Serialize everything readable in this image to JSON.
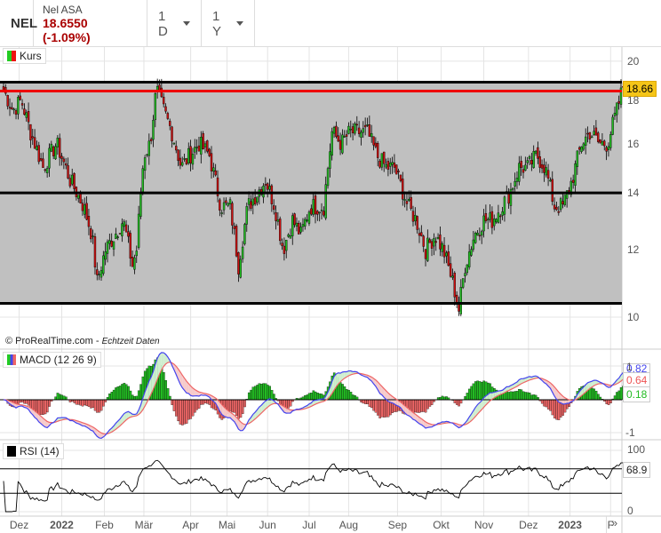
{
  "header": {
    "symbol": "NEL",
    "name": "Nel ASA",
    "price": "18.6550 (-1.09%)",
    "interval": "1 D",
    "range": "1 Y"
  },
  "panels": {
    "price_label": "Kurs",
    "macd_label": "MACD (12 26 9)",
    "rsi_label": "RSI (14)",
    "credit": "© ProRealTime.com",
    "credit_sub": "Echtzeit Daten",
    "more_icon": "»"
  },
  "colors": {
    "up": "#22bb22",
    "down": "#cc1111",
    "macd": "#4444ee",
    "signal": "#ee6666",
    "band": "#c0c0c0",
    "last": "#f5c518"
  },
  "chart_data": {
    "type": "candlestick",
    "x_unit": "weeks since start",
    "price_axis": {
      "ticks": [
        "20",
        "18",
        "16",
        "14",
        "12",
        "10"
      ],
      "range": [
        9.6,
        20.6
      ],
      "scale": "log"
    },
    "x_ticks": [
      {
        "label": "Dez",
        "w": 1.5
      },
      {
        "label": "2022",
        "w": 5.6,
        "bold": true
      },
      {
        "label": "Feb",
        "w": 9.7
      },
      {
        "label": "Mär",
        "w": 13.5
      },
      {
        "label": "Apr",
        "w": 18
      },
      {
        "label": "Mai",
        "w": 21.5
      },
      {
        "label": "Jun",
        "w": 25.4
      },
      {
        "label": "Jul",
        "w": 29.4
      },
      {
        "label": "Aug",
        "w": 33.2
      },
      {
        "label": "Sep",
        "w": 37.9
      },
      {
        "label": "Okt",
        "w": 42.1
      },
      {
        "label": "Nov",
        "w": 46.2
      },
      {
        "label": "Dez",
        "w": 50.5
      },
      {
        "label": "2023",
        "w": 54.5,
        "bold": true
      },
      {
        "label": "F",
        "w": 58.4
      }
    ],
    "closes": [
      [
        0,
        18.5
      ],
      [
        0.9,
        17.5
      ],
      [
        1.7,
        18
      ],
      [
        2.6,
        16.5
      ],
      [
        3.8,
        15
      ],
      [
        5.1,
        16
      ],
      [
        6.4,
        14.5
      ],
      [
        7.7,
        13.5
      ],
      [
        8.5,
        12.5
      ],
      [
        9,
        11
      ],
      [
        9.8,
        12
      ],
      [
        10.7,
        12.5
      ],
      [
        11.5,
        13
      ],
      [
        12.4,
        11.5
      ],
      [
        12.8,
        12
      ],
      [
        13.5,
        15.5
      ],
      [
        14.1,
        16
      ],
      [
        14.7,
        18.5
      ],
      [
        15.4,
        17.5
      ],
      [
        16.2,
        16.5
      ],
      [
        17.1,
        15
      ],
      [
        17.9,
        15.5
      ],
      [
        18.8,
        16
      ],
      [
        19.8,
        15.5
      ],
      [
        20.9,
        13.5
      ],
      [
        21.8,
        13.5
      ],
      [
        22.6,
        11.5
      ],
      [
        23.5,
        13.5
      ],
      [
        24.4,
        14
      ],
      [
        25.2,
        14.5
      ],
      [
        26.1,
        13.5
      ],
      [
        26.9,
        12
      ],
      [
        27.8,
        13
      ],
      [
        28.6,
        12.5
      ],
      [
        29.5,
        13.5
      ],
      [
        30.8,
        13.5
      ],
      [
        31.6,
        16.5
      ],
      [
        32.5,
        16
      ],
      [
        33.3,
        16.5
      ],
      [
        34.2,
        16.5
      ],
      [
        35,
        16.5
      ],
      [
        35.9,
        15.5
      ],
      [
        36.8,
        15
      ],
      [
        37.6,
        15
      ],
      [
        38.9,
        13.5
      ],
      [
        39.7,
        13
      ],
      [
        40.6,
        12
      ],
      [
        41.5,
        12.5
      ],
      [
        42.3,
        12
      ],
      [
        43.2,
        11
      ],
      [
        43.8,
        10.2
      ],
      [
        44.4,
        11.5
      ],
      [
        45.3,
        12.5
      ],
      [
        46.2,
        13
      ],
      [
        47,
        13
      ],
      [
        47.9,
        13.5
      ],
      [
        48.7,
        14
      ],
      [
        49.6,
        15
      ],
      [
        50.4,
        15
      ],
      [
        51.3,
        15.5
      ],
      [
        52.1,
        15
      ],
      [
        53,
        13.5
      ],
      [
        53.8,
        13.5
      ],
      [
        54.7,
        14.5
      ],
      [
        55.6,
        16
      ],
      [
        56.4,
        16.5
      ],
      [
        57.3,
        16
      ],
      [
        58.1,
        16
      ],
      [
        59,
        17.5
      ],
      [
        59.6,
        18.66
      ]
    ],
    "levels": [
      {
        "value": 18.9,
        "color": "#000"
      },
      {
        "value": 18.45,
        "color": "#e00"
      },
      {
        "value": 14.0,
        "color": "#000"
      },
      {
        "value": 10.38,
        "color": "#000"
      }
    ],
    "band": [
      10.38,
      18.9
    ],
    "last_price": "18.66",
    "macd": {
      "ticks": [
        "1",
        "-1"
      ],
      "range": [
        -1.45,
        1.45
      ],
      "values": {
        "macd": "0.82",
        "signal": "0.64",
        "hist": "0.18"
      }
    },
    "rsi": {
      "ticks": [
        "100",
        "0"
      ],
      "levels": [
        70,
        30
      ],
      "value": "68.9"
    }
  }
}
